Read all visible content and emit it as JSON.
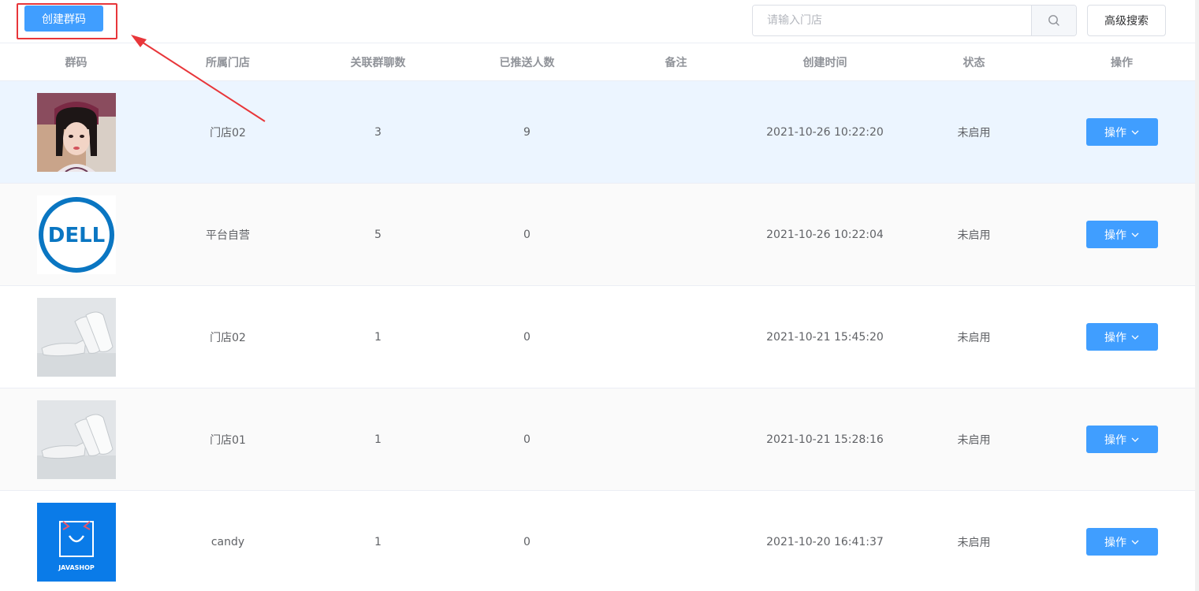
{
  "toolbar": {
    "create_label": "创建群码",
    "search_placeholder": "请输入门店",
    "search_value": "",
    "advanced_label": "高级搜索"
  },
  "columns": [
    "群码",
    "所属门店",
    "关联群聊数",
    "已推送人数",
    "备注",
    "创建时间",
    "状态",
    "操作"
  ],
  "rows": [
    {
      "image": "portrait-photo",
      "store": "门店02",
      "groups": "3",
      "pushed": "9",
      "remark": "",
      "created": "2021-10-26 10:22:20",
      "status": "未启用",
      "op": "操作"
    },
    {
      "image": "dell-logo",
      "store": "平台自营",
      "groups": "5",
      "pushed": "0",
      "remark": "",
      "created": "2021-10-26 10:22:04",
      "status": "未启用",
      "op": "操作"
    },
    {
      "image": "pillows-photo",
      "store": "门店02",
      "groups": "1",
      "pushed": "0",
      "remark": "",
      "created": "2021-10-21 15:45:20",
      "status": "未启用",
      "op": "操作"
    },
    {
      "image": "pillows-photo",
      "store": "门店01",
      "groups": "1",
      "pushed": "0",
      "remark": "",
      "created": "2021-10-21 15:28:16",
      "status": "未启用",
      "op": "操作"
    },
    {
      "image": "javashop-logo",
      "store": "candy",
      "groups": "1",
      "pushed": "0",
      "remark": "",
      "created": "2021-10-20 16:41:37",
      "status": "未启用",
      "op": "操作"
    }
  ],
  "logo_text": {
    "dell": "DELL",
    "javashop": "JAVASHOP"
  },
  "colors": {
    "primary": "#409eff",
    "annotation": "#e8363a",
    "selected_row": "#ecf5ff"
  }
}
